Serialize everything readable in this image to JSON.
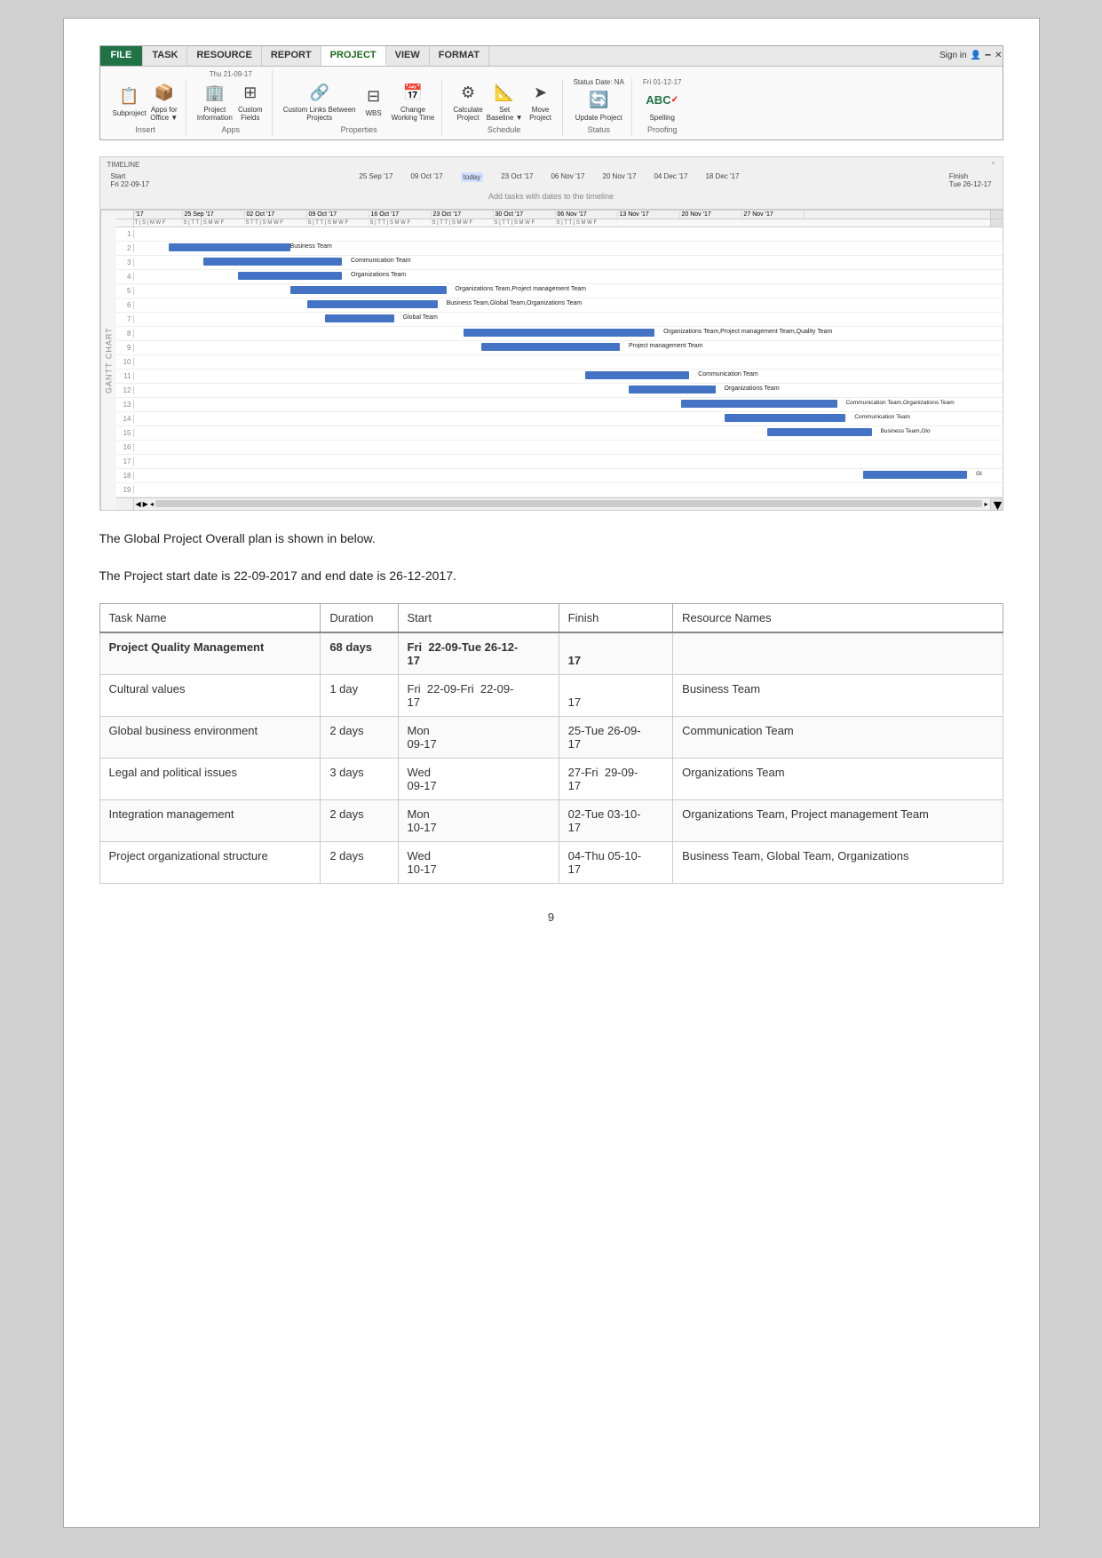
{
  "ribbon": {
    "tabs": [
      {
        "label": "FILE",
        "class": "file"
      },
      {
        "label": "TASK",
        "class": ""
      },
      {
        "label": "RESOURCE",
        "class": ""
      },
      {
        "label": "REPORT",
        "class": ""
      },
      {
        "label": "PROJECT",
        "class": "active"
      },
      {
        "label": "VIEW",
        "class": ""
      },
      {
        "label": "FORMAT",
        "class": ""
      }
    ],
    "groups": [
      {
        "label": "Insert",
        "icons": [
          {
            "name": "Subproject",
            "symbol": "📋"
          },
          {
            "name": "Apps for\nOffice ▼",
            "symbol": "📦"
          }
        ]
      },
      {
        "label": "Apps",
        "date": "Thu 21-09-17",
        "icons": [
          {
            "name": "Project\nInformation",
            "symbol": "🏢"
          },
          {
            "name": "Custom\nFields",
            "symbol": "⊞"
          }
        ]
      },
      {
        "label": "Properties",
        "icons": [
          {
            "name": "Custom Links\nBetween Projects",
            "symbol": "🔗"
          },
          {
            "name": "WBS",
            "symbol": "⊟"
          }
        ]
      },
      {
        "label": "Properties",
        "icons": [
          {
            "name": "Change\nWorking Time",
            "symbol": "📅"
          }
        ]
      },
      {
        "label": "Schedule",
        "icons": [
          {
            "name": "Calculate\nProject",
            "symbol": "⚙"
          },
          {
            "name": "Set\nBaseline ▼",
            "symbol": "📐"
          },
          {
            "name": "Move\nProject",
            "symbol": "➤"
          }
        ]
      },
      {
        "label": "Status",
        "statusDate": "Status Date: NA",
        "icons": [
          {
            "name": "Update Project",
            "symbol": "🔄"
          }
        ]
      },
      {
        "label": "Proofing",
        "date": "Fri 01-12-17",
        "icons": [
          {
            "name": "Spelling",
            "symbol": "ABC"
          }
        ]
      }
    ],
    "signIn": "Sign in"
  },
  "timeline": {
    "start": "Start\nFri 22-09-17",
    "finish": "Finish\nTue 26-12-17",
    "today": "today",
    "dates": [
      "25 Sep '17",
      "09 Oct '17",
      "23 Oct '17",
      "06 Nov '17",
      "20 Nov '17",
      "04 Dec '17",
      "18 Dec '17"
    ],
    "addTasksLabel": "Add tasks with dates to the timeline"
  },
  "gantt": {
    "label": "GANTT CHART",
    "dateHeaders": [
      "'17",
      "25 Sep '17",
      "02 Oct '17",
      "09 Oct '17",
      "16 Oct '17",
      "23 Oct '17",
      "30 Oct '17",
      "06 Nov '17",
      "13 Nov '17",
      "20 Nov '17",
      "27 Nov '17"
    ],
    "rows": [
      {
        "num": 1,
        "bar": null,
        "label": ""
      },
      {
        "num": 2,
        "bar": {
          "left": "5%",
          "width": "15%",
          "color": "#4472c4"
        },
        "label": "Business Team"
      },
      {
        "num": 3,
        "bar": {
          "left": "10%",
          "width": "18%",
          "color": "#4472c4"
        },
        "label": "Communication Team"
      },
      {
        "num": 4,
        "bar": {
          "left": "14%",
          "width": "16%",
          "color": "#4472c4"
        },
        "label": "Organizations Team"
      },
      {
        "num": 5,
        "bar": {
          "left": "20%",
          "width": "22%",
          "color": "#4472c4"
        },
        "label": "Organizations Team,Project management Team"
      },
      {
        "num": 6,
        "bar": {
          "left": "22%",
          "width": "24%",
          "color": "#4472c4"
        },
        "label": "Business Team,Global Team,Organizations Team"
      },
      {
        "num": 7,
        "bar": {
          "left": "24%",
          "width": "10%",
          "color": "#4472c4"
        },
        "label": "Global Team"
      },
      {
        "num": 8,
        "bar": {
          "left": "40%",
          "width": "28%",
          "color": "#4472c4"
        },
        "label": "Organizations Team,Project management Team,Quality Team"
      },
      {
        "num": 9,
        "bar": {
          "left": "43%",
          "width": "18%",
          "color": "#4472c4"
        },
        "label": "Project management Team"
      },
      {
        "num": 10,
        "bar": null,
        "label": ""
      },
      {
        "num": 11,
        "bar": {
          "left": "55%",
          "width": "14%",
          "color": "#4472c4"
        },
        "label": "Communication Team"
      },
      {
        "num": 12,
        "bar": {
          "left": "60%",
          "width": "12%",
          "color": "#4472c4"
        },
        "label": "Organizations Team"
      },
      {
        "num": 13,
        "bar": {
          "left": "66%",
          "width": "22%",
          "color": "#4472c4"
        },
        "label": "Communication Team,Organizations Team"
      },
      {
        "num": 14,
        "bar": {
          "left": "72%",
          "width": "18%",
          "color": "#4472c4"
        },
        "label": "Communication Team"
      },
      {
        "num": 15,
        "bar": {
          "left": "76%",
          "width": "16%",
          "color": "#4472c4"
        },
        "label": "Business Team,Glo"
      },
      {
        "num": 16,
        "bar": null,
        "label": ""
      },
      {
        "num": 17,
        "bar": null,
        "label": ""
      },
      {
        "num": 18,
        "bar": {
          "left": "88%",
          "width": "10%",
          "color": "#4472c4"
        },
        "label": "Gl"
      },
      {
        "num": 19,
        "bar": null,
        "label": ""
      }
    ]
  },
  "body": {
    "line1": "The Global Project Overall plan is shown in below.",
    "line2": "The Project start date is 22-09-2017 and end date is 26-12-2017."
  },
  "table": {
    "headers": [
      "Task Name",
      "Duration",
      "Start",
      "Finish",
      "Resource Names"
    ],
    "rows": [
      {
        "bold": true,
        "task": "Project Quality Management",
        "duration": "68 days",
        "start": "Fri  22-09-",
        "start2": "17",
        "finish": "Tue 26-12-",
        "finish2": "17",
        "resources": ""
      },
      {
        "bold": false,
        "task": "Cultural values",
        "duration": "1 day",
        "start": "Fri  22-09-Fri",
        "start2": "17",
        "finish": "22-09-",
        "finish2": "17",
        "resources": "Business Team"
      },
      {
        "bold": false,
        "task": "Global business environment",
        "duration": "2 days",
        "start": "Mon",
        "start2": "09-17",
        "finish": "25-Tue 26-09-",
        "finish2": "17",
        "resources": "Communication Team"
      },
      {
        "bold": false,
        "task": "Legal and political issues",
        "duration": "3 days",
        "start": "Wed",
        "start2": "09-17",
        "finish": "27-Fri  29-09-",
        "finish2": "17",
        "resources": "Organizations Team"
      },
      {
        "bold": false,
        "task": "Integration management",
        "duration": "2 days",
        "start": "Mon",
        "start2": "10-17",
        "finish": "02-Tue 03-10-",
        "finish2": "17",
        "resources": "Organizations Team, Project management Team"
      },
      {
        "bold": false,
        "task": "Project organizational structure",
        "duration": "2 days",
        "start": "Wed",
        "start2": "10-17",
        "finish": "04-Thu 05-10-",
        "finish2": "17",
        "resources": "Business Team, Global Team, Organizations"
      }
    ]
  },
  "tableRowsData": [
    {
      "task_name": "Project Quality Management",
      "duration": "68 days",
      "start_line1": "Fri  22-09-Tue 26-12-",
      "start_line2": "17",
      "finish_line1": "",
      "finish_line2": "17",
      "resources": ""
    },
    {
      "task_name": "Cultural values",
      "duration": "1 day",
      "start_line1": "Fri",
      "start_line2": "17",
      "start_date": "22-09-",
      "finish_line1": "Fri  22-09-",
      "finish_line2": "17",
      "resources": "Business Team"
    },
    {
      "task_name": "Global business environment",
      "duration": "2 days",
      "start_line1": "Mon",
      "start_line2": "09-17",
      "start_date": "25-",
      "finish_line1": "Tue 26-09-",
      "finish_line2": "17",
      "resources": "Communication Team"
    },
    {
      "task_name": "Legal and political issues",
      "duration": "3 days",
      "start_line1": "Wed",
      "start_line2": "09-17",
      "start_date": "27-",
      "finish_line1": "Fri  29-09-",
      "finish_line2": "17",
      "resources": "Organizations Team"
    },
    {
      "task_name": "Integration management",
      "duration": "2 days",
      "start_line1": "Mon",
      "start_line2": "10-17",
      "start_date": "02-",
      "finish_line1": "Tue 03-10-",
      "finish_line2": "17",
      "resources": "Organizations Team, Project management Team"
    },
    {
      "task_name": "Project organizational structure",
      "duration": "2 days",
      "start_line1": "Wed",
      "start_line2": "10-17",
      "start_date": "04-",
      "finish_line1": "Thu 05-10-",
      "finish_line2": "17",
      "resources": "Business Team, Global Team, Organizations"
    }
  ],
  "pageNumber": "9"
}
